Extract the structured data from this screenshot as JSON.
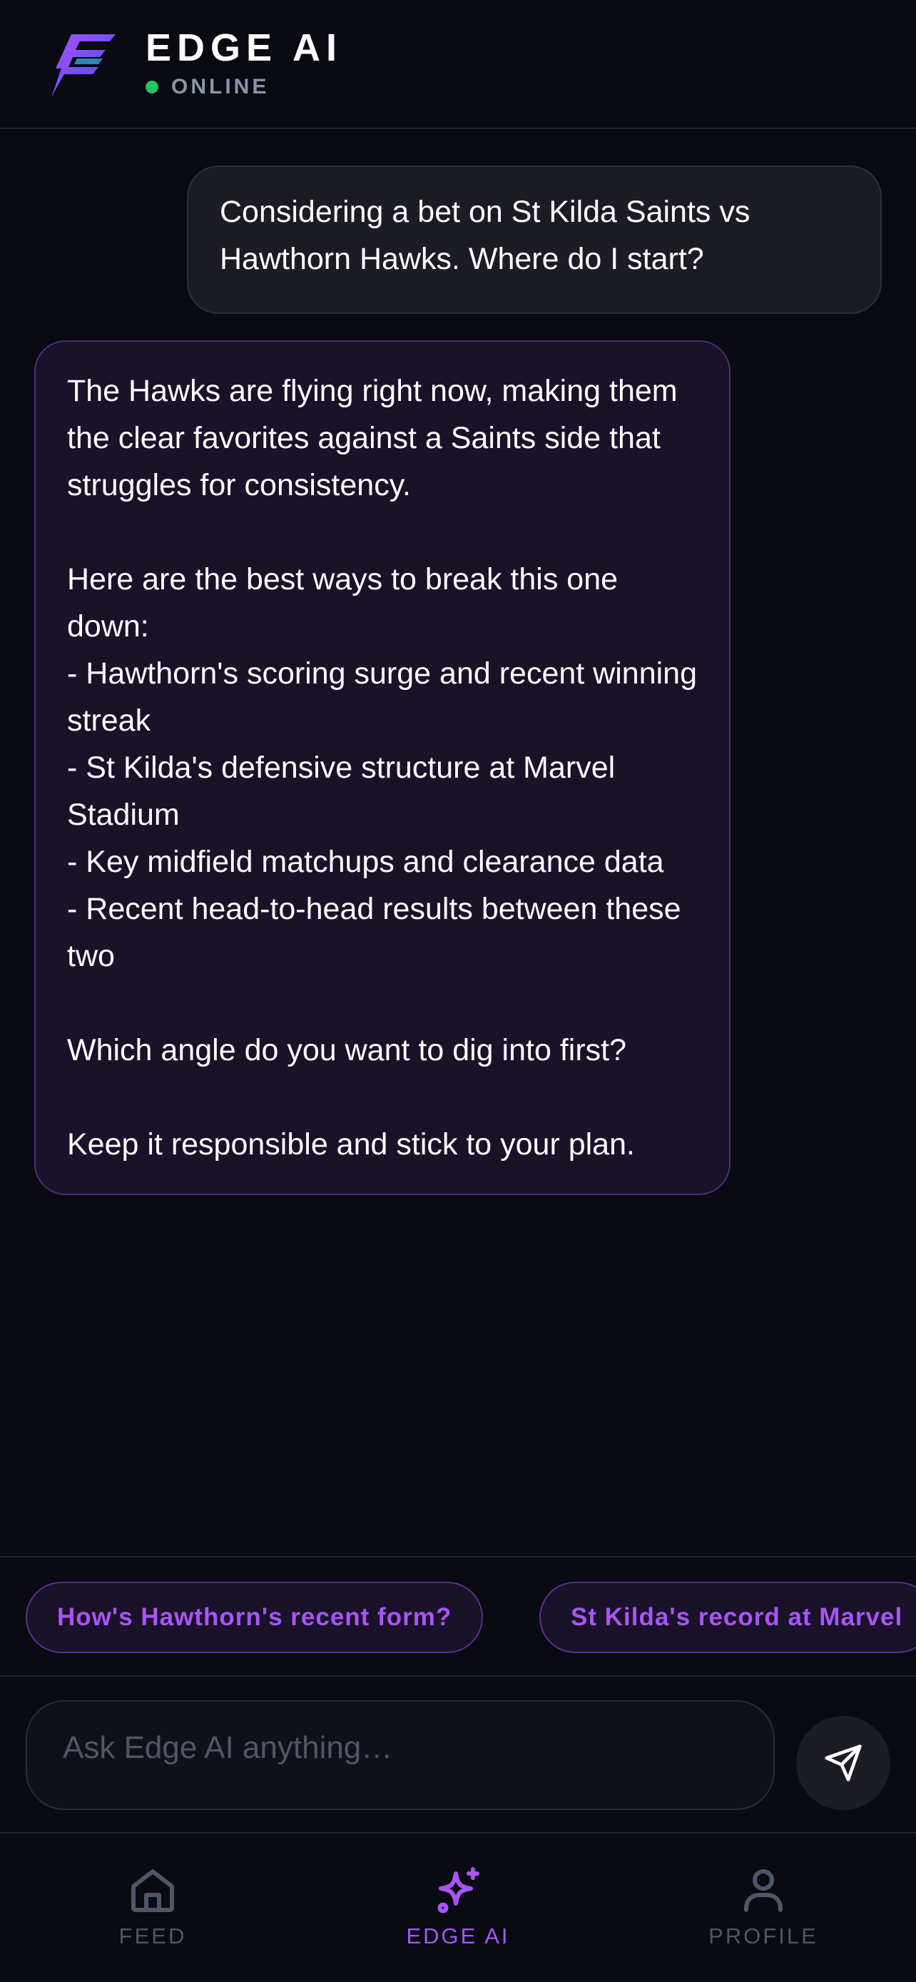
{
  "header": {
    "title": "EDGE AI",
    "status": "ONLINE",
    "status_color": "#22c55e"
  },
  "messages": [
    {
      "role": "user",
      "text": "Considering a bet on St Kilda Saints vs Hawthorn Hawks. Where do I start?"
    },
    {
      "role": "assistant",
      "text": "The Hawks are flying right now, making them the clear favorites against a Saints side that struggles for consistency.\n\nHere are the best ways to break this one down:\n- Hawthorn's scoring surge and recent winning streak\n- St Kilda's defensive structure at Marvel Stadium\n- Key midfield matchups and clearance data\n- Recent head-to-head results between these two\n\nWhich angle do you want to dig into first?\n\nKeep it responsible and stick to your plan."
    }
  ],
  "suggestions": [
    "How's Hawthorn's recent form?",
    "St Kilda's record at Marvel"
  ],
  "input": {
    "placeholder": "Ask Edge AI anything…",
    "value": ""
  },
  "nav": {
    "items": [
      {
        "label": "FEED",
        "icon": "home-icon",
        "active": false
      },
      {
        "label": "EDGE AI",
        "icon": "sparkle-icon",
        "active": true
      },
      {
        "label": "PROFILE",
        "icon": "user-icon",
        "active": false
      }
    ]
  },
  "colors": {
    "background": "#090a12",
    "accent": "#a855f7",
    "user_bubble": "#1c1d24",
    "ai_bubble": "#1a1228",
    "muted": "#4f5668"
  }
}
